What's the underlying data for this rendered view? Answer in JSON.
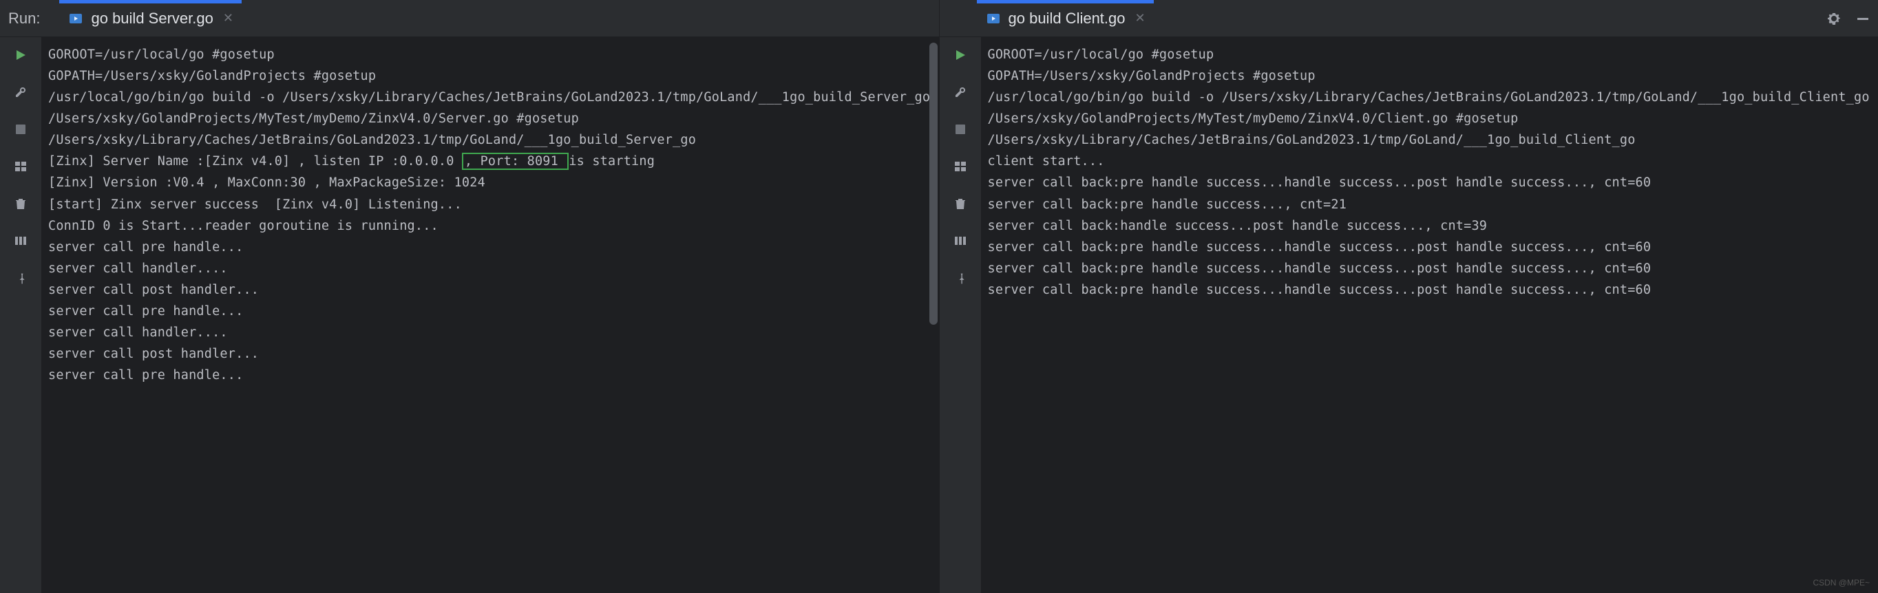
{
  "left": {
    "run_label": "Run:",
    "tab_label": "go build Server.go",
    "output_html": "GOROOT=/usr/local/go #gosetup\nGOPATH=/Users/xsky/GolandProjects #gosetup\n/usr/local/go/bin/go build -o /Users/xsky/Library/Caches/JetBrains/GoLand2023.1/tmp/GoLand/___1go_build_Server_go /Users/xsky/GolandProjects/MyTest/myDemo/ZinxV4.0/Server.go #gosetup\n/Users/xsky/Library/Caches/JetBrains/GoLand2023.1/tmp/GoLand/___1go_build_Server_go\n[Zinx] Server Name :[Zinx v4.0] , listen IP :0.0.0.0 <span class=\"hl\">, Port: 8091 </span>is starting\n[Zinx] Version :V0.4 , MaxConn:30 , MaxPackageSize: 1024\n[start] Zinx server success  [Zinx v4.0] Listening...\nConnID 0 is Start...reader goroutine is running...\nserver call pre handle...\nserver call handler....\nserver call post handler...\nserver call pre handle...\nserver call handler....\nserver call post handler...\nserver call pre handle..."
  },
  "right": {
    "tab_label": "go build Client.go",
    "output": "GOROOT=/usr/local/go #gosetup\nGOPATH=/Users/xsky/GolandProjects #gosetup\n/usr/local/go/bin/go build -o /Users/xsky/Library/Caches/JetBrains/GoLand2023.1/tmp/GoLand/___1go_build_Client_go /Users/xsky/GolandProjects/MyTest/myDemo/ZinxV4.0/Client.go #gosetup\n/Users/xsky/Library/Caches/JetBrains/GoLand2023.1/tmp/GoLand/___1go_build_Client_go\nclient start...\nserver call back:pre handle success...handle success...post handle success..., cnt=60\nserver call back:pre handle success..., cnt=21\nserver call back:handle success...post handle success..., cnt=39\nserver call back:pre handle success...handle success...post handle success..., cnt=60\nserver call back:pre handle success...handle success...post handle success..., cnt=60\nserver call back:pre handle success...handle success...post handle success..., cnt=60"
  },
  "watermark": "CSDN @MPE~"
}
